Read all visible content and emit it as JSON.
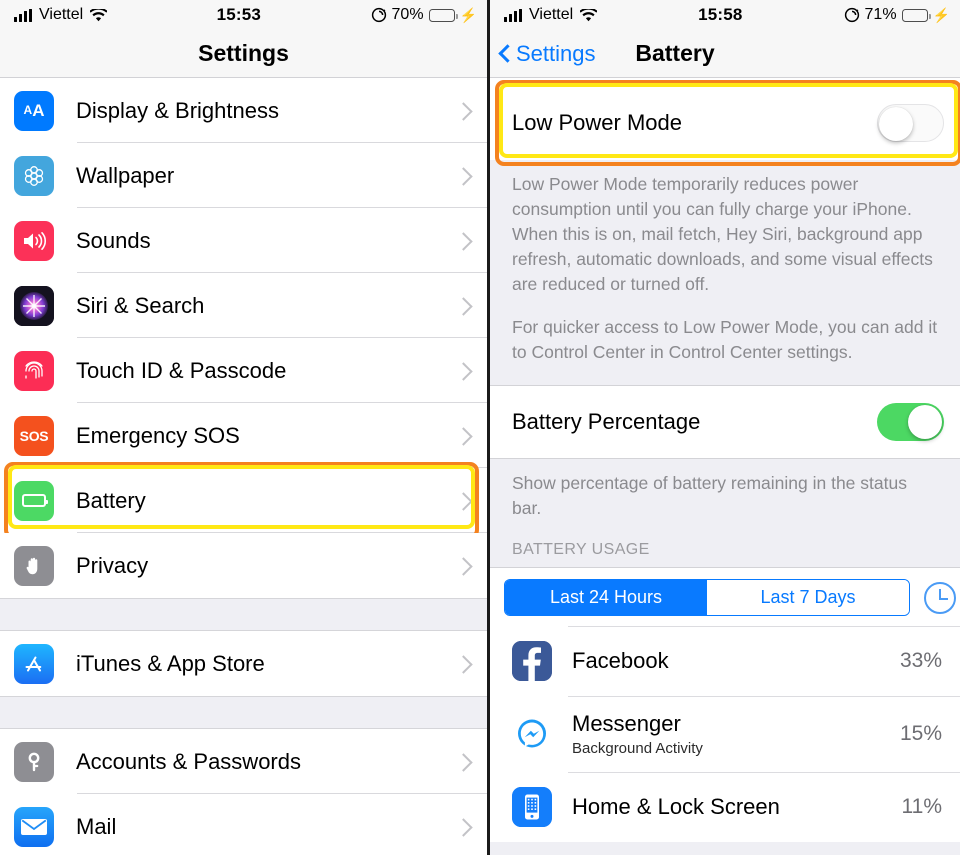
{
  "left_phone": {
    "status_bar": {
      "carrier": "Viettel",
      "signal_icon": "cellular-bars-icon",
      "wifi_icon": "wifi-icon",
      "time": "15:53",
      "rotation_lock_icon": "rotation-lock-icon",
      "battery_percent": "70%",
      "battery_level": 70,
      "charging_icon": "lightning-bolt-icon"
    },
    "nav": {
      "title": "Settings"
    },
    "groups": [
      {
        "rows": [
          {
            "label": "Display & Brightness",
            "icon": "display-brightness-icon",
            "icon_color": "#007aff",
            "chevron": "chevron-right-icon"
          },
          {
            "label": "Wallpaper",
            "icon": "wallpaper-icon",
            "icon_color": "#43a6dd",
            "chevron": "chevron-right-icon"
          },
          {
            "label": "Sounds",
            "icon": "sounds-icon",
            "icon_color": "#fc3158",
            "chevron": "chevron-right-icon"
          },
          {
            "label": "Siri & Search",
            "icon": "siri-icon",
            "icon_color": "#1c1c2e",
            "chevron": "chevron-right-icon"
          },
          {
            "label": "Touch ID & Passcode",
            "icon": "touch-id-icon",
            "icon_color": "#fc2d55",
            "chevron": "chevron-right-icon"
          },
          {
            "label": "Emergency SOS",
            "icon": "emergency-sos-icon",
            "icon_color": "#f4511e",
            "chevron": "chevron-right-icon"
          },
          {
            "label": "Battery",
            "icon": "battery-icon",
            "icon_color": "#4cd964",
            "chevron": "chevron-right-icon",
            "highlighted": true
          },
          {
            "label": "Privacy",
            "icon": "privacy-hand-icon",
            "icon_color": "#8e8e93",
            "chevron": "chevron-right-icon"
          }
        ]
      },
      {
        "rows": [
          {
            "label": "iTunes & App Store",
            "icon": "app-store-icon",
            "icon_color": "#1b8cf3",
            "chevron": "chevron-right-icon"
          }
        ]
      },
      {
        "rows": [
          {
            "label": "Accounts & Passwords",
            "icon": "accounts-passwords-key-icon",
            "icon_color": "#8e8e93",
            "chevron": "chevron-right-icon"
          },
          {
            "label": "Mail",
            "icon": "mail-icon",
            "icon_color": "#1f8df5",
            "chevron": "chevron-right-icon"
          }
        ]
      }
    ]
  },
  "right_phone": {
    "status_bar": {
      "carrier": "Viettel",
      "signal_icon": "cellular-bars-icon",
      "wifi_icon": "wifi-icon",
      "time": "15:58",
      "rotation_lock_icon": "rotation-lock-icon",
      "battery_percent": "71%",
      "battery_level": 71,
      "charging_icon": "lightning-bolt-icon"
    },
    "nav": {
      "back_label": "Settings",
      "back_icon": "chevron-left-icon",
      "title": "Battery"
    },
    "low_power_mode": {
      "label": "Low Power Mode",
      "toggle_state": "off",
      "highlighted": true
    },
    "footnote_1": "Low Power Mode temporarily reduces power consumption until you can fully charge your iPhone. When this is on, mail fetch, Hey Siri, background app refresh, automatic downloads, and some visual effects are reduced or turned off.",
    "footnote_2": "For quicker access to Low Power Mode, you can add it to Control Center in Control Center settings.",
    "battery_percentage": {
      "label": "Battery Percentage",
      "toggle_state": "on"
    },
    "footnote_3": "Show percentage of battery remaining in the status bar.",
    "section_header": "BATTERY USAGE",
    "segmented_control": {
      "options": [
        "Last 24 Hours",
        "Last 7 Days"
      ],
      "selected_index": 0,
      "clock_icon": "clock-icon"
    },
    "usage_rows": [
      {
        "name": "Facebook",
        "subtitle": "",
        "percent": "33%",
        "icon": "facebook-icon",
        "icon_color": "#3b5998"
      },
      {
        "name": "Messenger",
        "subtitle": "Background Activity",
        "percent": "15%",
        "icon": "messenger-icon",
        "icon_color": "#ffffff"
      },
      {
        "name": "Home & Lock Screen",
        "subtitle": "",
        "percent": "11%",
        "icon": "home-lock-screen-icon",
        "icon_color": "#147efb"
      }
    ]
  },
  "annotations": {
    "highlight_yellow": "#ffe815",
    "highlight_orange": "#f4821f"
  }
}
